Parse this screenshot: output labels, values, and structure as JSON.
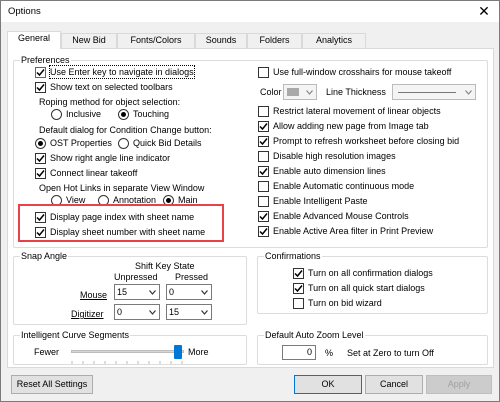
{
  "window": {
    "title": "Options",
    "close_glyph": "✕"
  },
  "tabs": [
    "General",
    "New Bid",
    "Fonts/Colors",
    "Sounds",
    "Folders",
    "Analytics"
  ],
  "preferences": {
    "label": "Preferences",
    "use_enter_key": {
      "label": "Use Enter key to navigate in dialogs",
      "checked": true
    },
    "show_text_toolbars": {
      "label": "Show text on selected toolbars",
      "checked": true
    },
    "roping_label": "Roping method for object selection:",
    "roping_inclusive": {
      "label": "Inclusive",
      "selected": false
    },
    "roping_touching": {
      "label": "Touching",
      "selected": true
    },
    "condition_label": "Default dialog for Condition Change button:",
    "ost_properties": {
      "label": "OST Properties",
      "selected": true
    },
    "quick_bid_details": {
      "label": "Quick Bid Details",
      "selected": false
    },
    "show_right_angle": {
      "label": "Show right angle line indicator",
      "checked": true
    },
    "connect_linear": {
      "label": "Connect linear takeoff",
      "checked": true
    },
    "hotlinks_label": "Open Hot Links in separate View Window",
    "hot_view": {
      "label": "View",
      "selected": false
    },
    "hot_annotation": {
      "label": "Annotation",
      "selected": false
    },
    "hot_main": {
      "label": "Main",
      "selected": true
    },
    "display_page_index": {
      "label": "Display page index with sheet name",
      "checked": true
    },
    "display_sheet_number": {
      "label": "Display sheet number with sheet name",
      "checked": true
    },
    "full_window_crosshairs": {
      "label": "Use full-window crosshairs for mouse takeoff",
      "checked": false
    },
    "color_label": "Color",
    "line_thickness_label": "Line Thickness",
    "restrict_lateral": {
      "label": "Restrict lateral movement of linear objects",
      "checked": false
    },
    "allow_new_page": {
      "label": "Allow adding new page from Image tab",
      "checked": true
    },
    "prompt_refresh": {
      "label": "Prompt to refresh worksheet before closing bid",
      "checked": true
    },
    "disable_high_res": {
      "label": "Disable high resolution images",
      "checked": false
    },
    "auto_dimension": {
      "label": "Enable auto dimension lines",
      "checked": true
    },
    "auto_continuous": {
      "label": "Enable Automatic continuous mode",
      "checked": false
    },
    "intelligent_paste": {
      "label": "Enable Intelligent Paste",
      "checked": false
    },
    "advanced_mouse": {
      "label": "Enable Advanced Mouse Controls",
      "checked": true
    },
    "active_area_filter": {
      "label": "Enable Active Area filter in Print Preview",
      "checked": true
    }
  },
  "snap_angle": {
    "label": "Snap Angle",
    "shift_key_state": "Shift Key State",
    "unpressed": "Unpressed",
    "pressed": "Pressed",
    "mouse_label": "Mouse",
    "digitizer_label": "Digitizer",
    "mouse_unpressed": "15",
    "mouse_pressed": "0",
    "digitizer_unpressed": "0",
    "digitizer_pressed": "15"
  },
  "confirmations": {
    "label": "Confirmations",
    "all_confirmation": {
      "label": "Turn on all confirmation dialogs",
      "checked": true
    },
    "all_quick_start": {
      "label": "Turn on all quick start dialogs",
      "checked": true
    },
    "bid_wizard": {
      "label": "Turn on bid wizard",
      "checked": false
    }
  },
  "curve": {
    "label": "Intelligent Curve Segments",
    "fewer": "Fewer",
    "more": "More",
    "level": 0.98
  },
  "zoom": {
    "label": "Default Auto Zoom Level",
    "value": "0",
    "unit": "%",
    "hint": "Set at Zero to turn Off"
  },
  "buttons": {
    "reset": "Reset All Settings",
    "ok": "OK",
    "cancel": "Cancel",
    "apply": "Apply"
  },
  "colors": {
    "highlight": "#e8414a",
    "slider_thumb": "#0078d7"
  }
}
